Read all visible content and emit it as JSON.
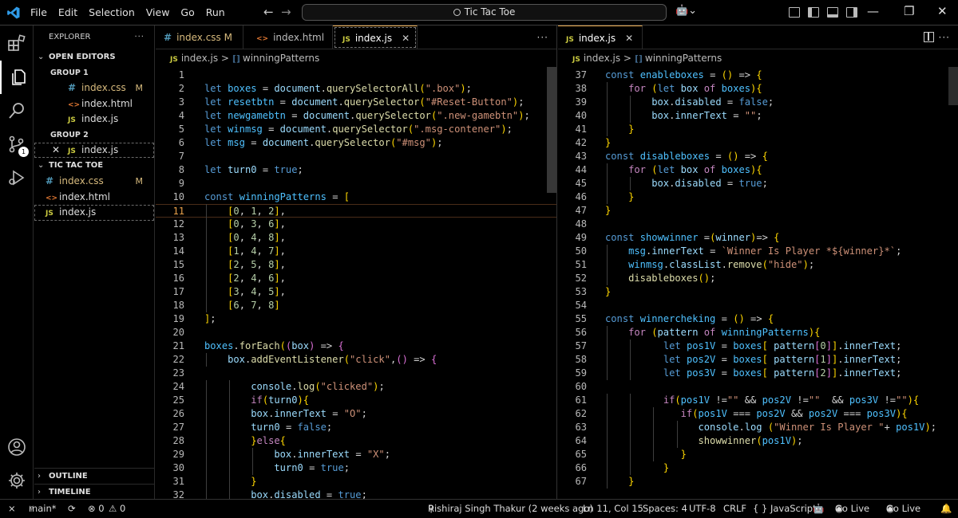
{
  "menu": [
    "File",
    "Edit",
    "Selection",
    "View",
    "Go",
    "Run"
  ],
  "window": {
    "title": "Tic Tac Toe",
    "more": "···",
    "minimize": "—",
    "restore": "❐",
    "close": "✕"
  },
  "sidebar": {
    "title": "EXPLORER",
    "more": "···",
    "open_editors": {
      "label": "OPEN EDITORS",
      "group1": {
        "label": "GROUP 1",
        "files": [
          {
            "icon": "#",
            "name": "index.css",
            "modified": "M"
          },
          {
            "icon": "<>",
            "name": "index.html"
          },
          {
            "icon": "JS",
            "name": "index.js"
          }
        ]
      },
      "group2": {
        "label": "GROUP 2",
        "files": [
          {
            "icon": "JS",
            "name": "index.js",
            "close": "✕"
          }
        ]
      }
    },
    "folder": {
      "label": "TIC TAC TOE",
      "files": [
        {
          "icon": "#",
          "name": "index.css",
          "modified": "M"
        },
        {
          "icon": "<>",
          "name": "index.html"
        },
        {
          "icon": "JS",
          "name": "index.js"
        }
      ]
    },
    "outline": "OUTLINE",
    "timeline": "TIMELINE"
  },
  "activity": {
    "scm_badge": "1"
  },
  "editor1": {
    "tabs": [
      {
        "icon": "#",
        "name": "index.css",
        "modified": "M"
      },
      {
        "icon": "<>",
        "name": "index.html"
      },
      {
        "icon": "JS",
        "name": "index.js",
        "close": "✕"
      }
    ],
    "breadcrumb": {
      "icon": "JS",
      "file": "index.js",
      "sep": ">",
      "symbol": "winningPatterns"
    },
    "more": "···"
  },
  "editor2": {
    "tabs": [
      {
        "icon": "JS",
        "name": "index.js",
        "close": "✕"
      }
    ],
    "breadcrumb": {
      "icon": "JS",
      "file": "index.js",
      "sep": ">",
      "symbol": "winningPatterns"
    },
    "more": "···"
  },
  "code_left": [
    {
      "n": "1",
      "t": ""
    },
    {
      "n": "2",
      "t": "let boxes = document.querySelectorAll(\".box\");"
    },
    {
      "n": "3",
      "t": "let resetbtn = document.querySelector(\"#Reset-Button\");"
    },
    {
      "n": "4",
      "t": "let newgamebtn = document.querySelector(\".new-gamebtn\");"
    },
    {
      "n": "5",
      "t": "let winmsg = document.querySelector(\".msg-contener\");"
    },
    {
      "n": "6",
      "t": "let msg = document.querySelector(\"#msg\");"
    },
    {
      "n": "7",
      "t": ""
    },
    {
      "n": "8",
      "t": "let turn0 = true;"
    },
    {
      "n": "9",
      "t": ""
    },
    {
      "n": "10",
      "t": "const winningPatterns = ["
    },
    {
      "n": "11",
      "t": "    [0, 1, 2],"
    },
    {
      "n": "12",
      "t": "    [0, 3, 6],"
    },
    {
      "n": "13",
      "t": "    [0, 4, 8],"
    },
    {
      "n": "14",
      "t": "    [1, 4, 7],"
    },
    {
      "n": "15",
      "t": "    [2, 5, 8],"
    },
    {
      "n": "16",
      "t": "    [2, 4, 6],"
    },
    {
      "n": "17",
      "t": "    [3, 4, 5],"
    },
    {
      "n": "18",
      "t": "    [6, 7, 8]"
    },
    {
      "n": "19",
      "t": "];"
    },
    {
      "n": "20",
      "t": ""
    },
    {
      "n": "21",
      "t": "boxes.forEach((box) => {"
    },
    {
      "n": "22",
      "t": "    box.addEventListener(\"click\",() => {"
    },
    {
      "n": "23",
      "t": ""
    },
    {
      "n": "24",
      "t": "        console.log(\"clicked\");"
    },
    {
      "n": "25",
      "t": "        if(turn0){"
    },
    {
      "n": "26",
      "t": "        box.innerText = \"O\";"
    },
    {
      "n": "27",
      "t": "        turn0 = false;"
    },
    {
      "n": "28",
      "t": "        }else{"
    },
    {
      "n": "29",
      "t": "            box.innerText = \"X\";"
    },
    {
      "n": "30",
      "t": "            turn0 = true;"
    },
    {
      "n": "31",
      "t": "        }"
    },
    {
      "n": "32",
      "t": "        box.disabled = true;"
    }
  ],
  "code_right": [
    {
      "n": "37",
      "t": "const enableboxes = () => {"
    },
    {
      "n": "38",
      "t": "    for (let box of boxes){"
    },
    {
      "n": "39",
      "t": "        box.disabled = false;"
    },
    {
      "n": "40",
      "t": "        box.innerText = \"\";"
    },
    {
      "n": "41",
      "t": "    }"
    },
    {
      "n": "42",
      "t": "}"
    },
    {
      "n": "43",
      "t": "const disableboxes = () => {"
    },
    {
      "n": "44",
      "t": "    for (let box of boxes){"
    },
    {
      "n": "45",
      "t": "        box.disabled = true;"
    },
    {
      "n": "46",
      "t": "    }"
    },
    {
      "n": "47",
      "t": "}"
    },
    {
      "n": "48",
      "t": ""
    },
    {
      "n": "49",
      "t": "const showwinner =(winner)=> {"
    },
    {
      "n": "50",
      "t": "    msg.innerText = `Winner Is Player *${winner}*`;"
    },
    {
      "n": "51",
      "t": "    winmsg.classList.remove(\"hide\");"
    },
    {
      "n": "52",
      "t": "    disableboxes();"
    },
    {
      "n": "53",
      "t": "}"
    },
    {
      "n": "54",
      "t": ""
    },
    {
      "n": "55",
      "t": "const winnercheking = () => {"
    },
    {
      "n": "56",
      "t": "    for (pattern of winningPatterns){"
    },
    {
      "n": "57",
      "t": "          let pos1V = boxes[ pattern[0]].innerText;"
    },
    {
      "n": "58",
      "t": "          let pos2V = boxes[ pattern[1]].innerText;"
    },
    {
      "n": "59",
      "t": "          let pos3V = boxes[ pattern[2]].innerText;"
    },
    {
      "n": "60",
      "t": ""
    },
    {
      "n": "61",
      "t": "          if(pos1V !=\"\" && pos2V !=\"\"  && pos3V !=\"\"){"
    },
    {
      "n": "62",
      "t": "             if(pos1V === pos2V && pos2V === pos3V){"
    },
    {
      "n": "63",
      "t": "                console.log (\"Winner Is Player \"+ pos1V);"
    },
    {
      "n": "64",
      "t": "                showwinner(pos1V);"
    },
    {
      "n": "65",
      "t": "             }"
    },
    {
      "n": "66",
      "t": "          }"
    },
    {
      "n": "67",
      "t": "    }"
    }
  ],
  "status": {
    "branch": "main*",
    "sync": "⟳",
    "errors": "⊗ 0",
    "warnings": "⚠ 0",
    "blame": "Rishiraj Singh Thakur (2 weeks ago)",
    "position": "Ln 11, Col 15",
    "spaces": "Spaces: 4",
    "encoding": "UTF-8",
    "eol": "CRLF",
    "language": "{ } JavaScript",
    "golive1": "Go Live",
    "golive2": "Go Live"
  },
  "colors": {
    "accent_tab": "#e7a84a",
    "css": "#519aba",
    "html": "#e37933",
    "js": "#cbcb41"
  }
}
